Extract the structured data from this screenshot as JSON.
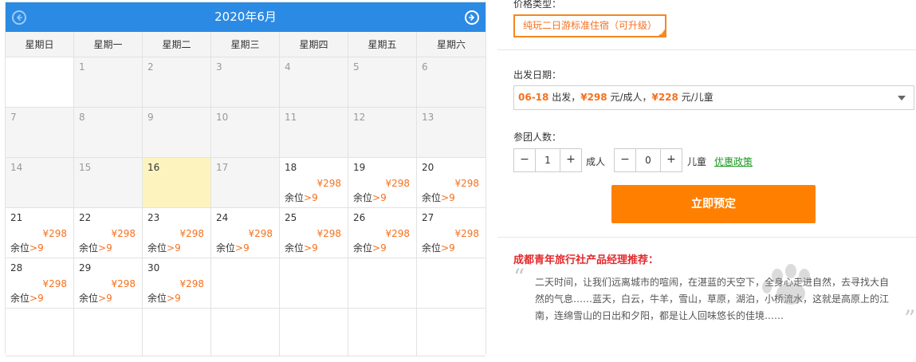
{
  "calendar": {
    "title": "2020年6月",
    "weekdays": [
      "星期日",
      "星期一",
      "星期二",
      "星期三",
      "星期四",
      "星期五",
      "星期六"
    ],
    "stock_prefix": "余位",
    "stock_value": ">9",
    "price": "¥298"
  },
  "panel": {
    "price_type_label": "价格类型：",
    "price_type_value": "纯玩二日游标准住宿（可升级）",
    "date_label": "出发日期：",
    "date_select": {
      "date": "06-18",
      "depart": " 出发，",
      "adult_price": "¥298",
      "adult_unit": " 元/成人，",
      "child_price": "¥228",
      "child_unit": " 元/儿童"
    },
    "people_label": "参团人数：",
    "adult_count": "1",
    "child_count": "0",
    "minus": "−",
    "plus": "+",
    "adult_unit": "成人",
    "child_unit": "儿童",
    "policy_link": "优惠政策",
    "book_button": "立即预定",
    "rec_title": "成都青年旅行社产品经理推荐：",
    "rec_text": "二天时间，让我们远离城市的喧闹，在湛蓝的天空下，全身心走进自然，去寻找大自然的气息……蓝天，白云，牛羊，雪山，草原，湖泊，小桥流水，这就是高原上的江南，连绵雪山的日出和夕阳，都是让人回味悠长的佳境……",
    "quote_open": "“",
    "quote_close": "”"
  },
  "colors": {
    "header_blue": "#2b8ae3",
    "accent_orange": "#f5711f",
    "book_orange": "#ff8000",
    "today_yellow": "#fdf3bf",
    "rec_red": "#e3292d",
    "link_green": "#1a9a20"
  }
}
